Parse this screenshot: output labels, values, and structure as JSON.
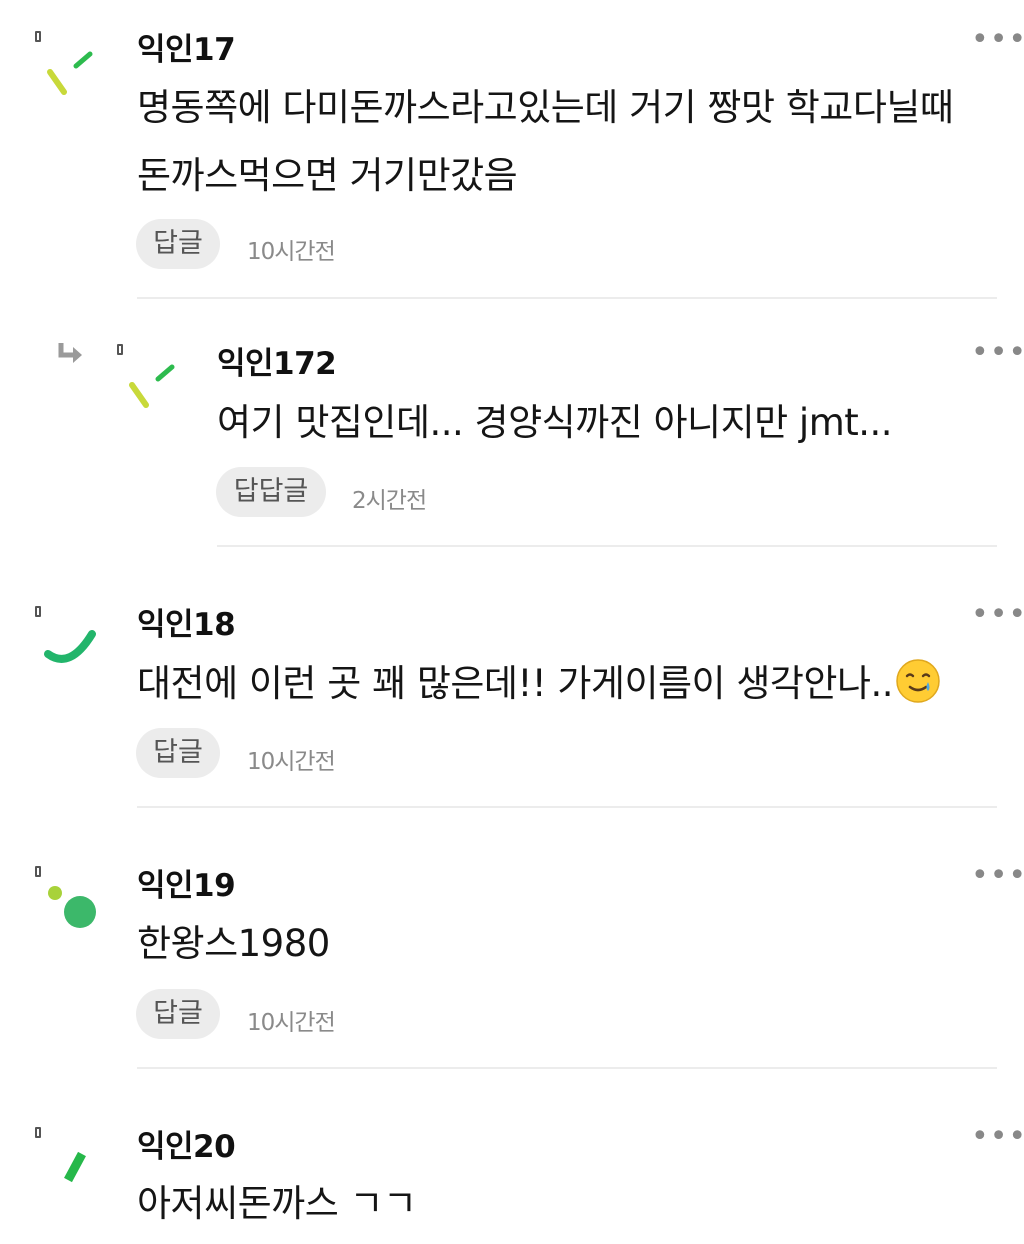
{
  "comments": [
    {
      "nickname": "익인17",
      "lines": [
        "명동쪽에 다미돈까스라고있는데 거기 짱맛 학교다닐때",
        "돈까스먹으면 거기만갔음"
      ],
      "reply_label": "답글",
      "time": "10시간전",
      "more": "•••",
      "avatar_icon": "confetti-lines-icon",
      "avatar_colors": [
        "#c8d93a",
        "#2dbb4e"
      ]
    },
    {
      "nickname": "익인172",
      "text": "여기 맛집인데... 경양식까진 아니지만 jmt...",
      "reply_label": "답답글",
      "time": "2시간전",
      "more": "•••",
      "is_reply": true,
      "avatar_icon": "confetti-lines-icon",
      "avatar_colors": [
        "#c8d93a",
        "#2dbb4e"
      ]
    },
    {
      "nickname": "익인18",
      "text": "대전에 이런 곳 꽤 많은데!! 가게이름이 생각안나..",
      "emoji": "smiling-face-with-tear-icon",
      "reply_label": "답글",
      "time": "10시간전",
      "more": "•••",
      "avatar_icon": "green-arc-icon",
      "avatar_colors": [
        "#22b56b"
      ]
    },
    {
      "nickname": "익인19",
      "text": "한왕스1980",
      "reply_label": "답글",
      "time": "10시간전",
      "more": "•••",
      "avatar_icon": "green-dots-icon",
      "avatar_colors": [
        "#a8d23a",
        "#3cb86a"
      ]
    },
    {
      "nickname": "익인20",
      "text": "아저씨돈까스 ㄱㄱ",
      "more": "•••",
      "avatar_icon": "green-slash-icon",
      "avatar_colors": [
        "#26b84a"
      ]
    }
  ]
}
